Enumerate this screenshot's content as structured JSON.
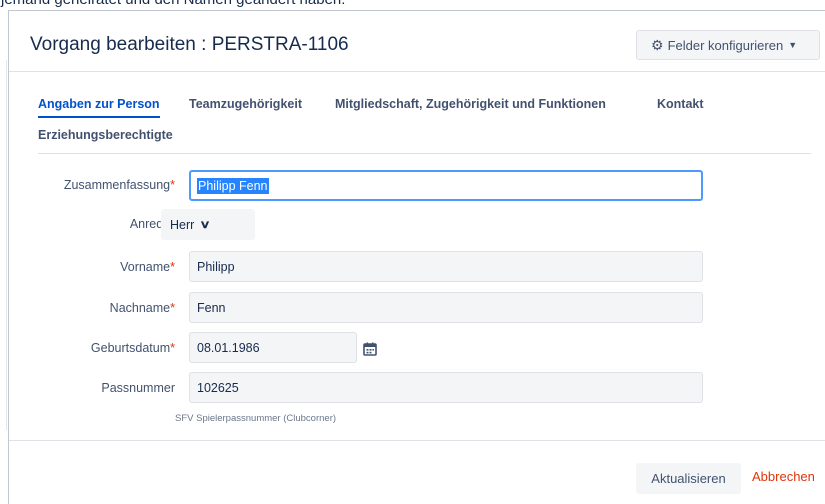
{
  "background": {
    "text": "jemand geheiratet und den Namen geändert haben."
  },
  "dialog": {
    "title": "Vorgang bearbeiten : PERSTRA-1106",
    "configure_button": "Felder konfigurieren",
    "configure_icon": "gear-icon"
  },
  "tabs": [
    {
      "label": "Angaben zur Person",
      "active": true
    },
    {
      "label": "Teamzugehörigkeit"
    },
    {
      "label": "Mitgliedschaft, Zugehörigkeit und Funktionen"
    },
    {
      "label": "Kontakt"
    },
    {
      "label": "Erziehungsberechtigte"
    }
  ],
  "form": {
    "required_marker": "*",
    "zusammenfassung": {
      "label": "Zusammenfassung",
      "value": "Philipp Fenn"
    },
    "anrede": {
      "label": "Anrede",
      "value": "Herr"
    },
    "vorname": {
      "label": "Vorname",
      "value": "Philipp"
    },
    "nachname": {
      "label": "Nachname",
      "value": "Fenn"
    },
    "geburtsdatum": {
      "label": "Geburtsdatum",
      "value": "08.01.1986"
    },
    "passnummer": {
      "label": "Passnummer",
      "value": "102625",
      "hint": "SFV Spielerpassnummer (Clubcorner)"
    }
  },
  "footer": {
    "update_button": "Aktualisieren",
    "cancel_link": "Abbrechen"
  },
  "colors": {
    "accent": "#0052cc",
    "required": "#de350b",
    "focus_border": "#4c9aff",
    "selection": "#2684ff"
  }
}
